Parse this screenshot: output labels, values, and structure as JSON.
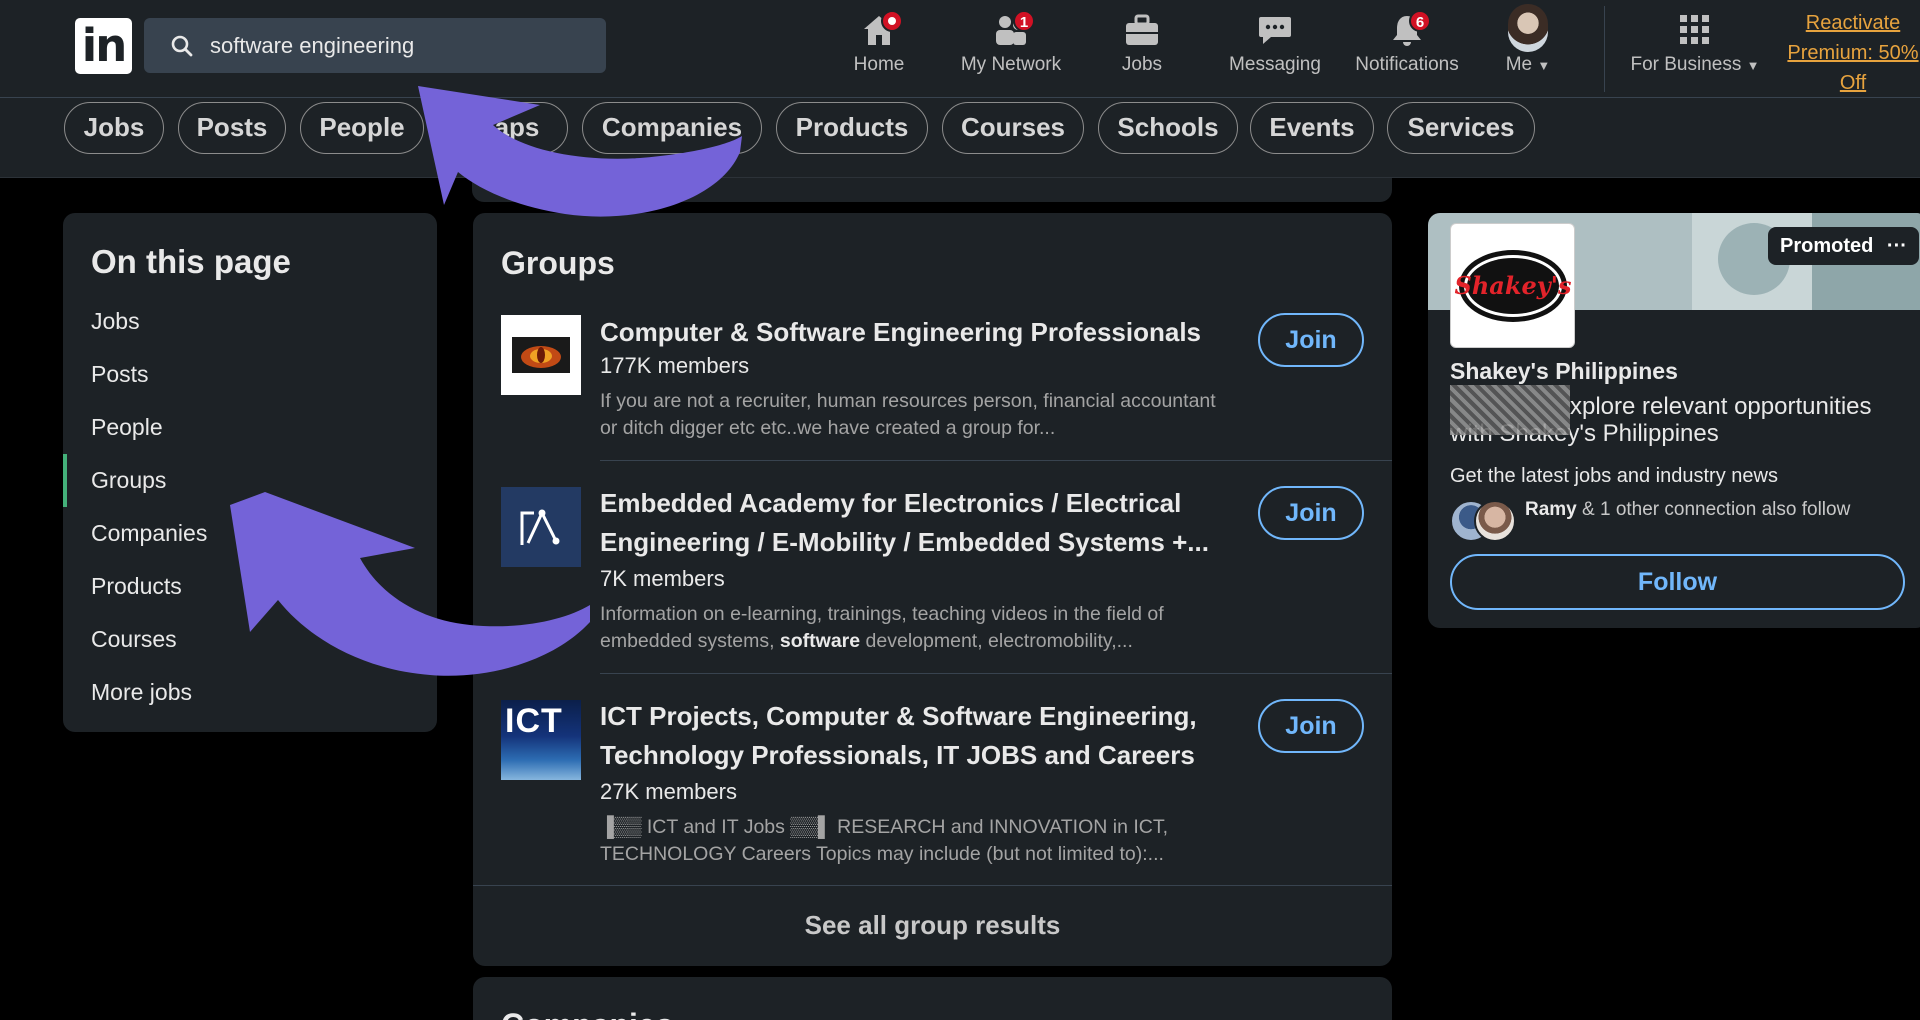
{
  "header": {
    "search": {
      "value": "software engineering"
    },
    "nav": [
      {
        "label": "Home",
        "badge": ""
      },
      {
        "label": "My Network",
        "badge": "1"
      },
      {
        "label": "Jobs",
        "badge": ""
      },
      {
        "label": "Messaging",
        "badge": ""
      },
      {
        "label": "Notifications",
        "badge": "6"
      },
      {
        "label": "Me",
        "badge": ""
      },
      {
        "label": "For Business",
        "badge": ""
      }
    ],
    "premium": {
      "line1": "Reactivate",
      "line2": "Premium: 50%",
      "line3": "Off"
    }
  },
  "filters": [
    "Jobs",
    "Posts",
    "People",
    "Groups",
    "Companies",
    "Products",
    "Courses",
    "Schools",
    "Events",
    "Services"
  ],
  "filters_visible": [
    "Jobs",
    "Posts",
    "People",
    "aps",
    "Companies",
    "Products",
    "Courses",
    "Schools",
    "Events",
    "Services"
  ],
  "sidebar": {
    "title": "On this page",
    "items": [
      "Jobs",
      "Posts",
      "People",
      "Groups",
      "Companies",
      "Products",
      "Courses",
      "More jobs"
    ],
    "active": "Groups"
  },
  "groups": {
    "title": "Groups",
    "join_label": "Join",
    "items": [
      {
        "name": "Computer & Software Engineering Professionals",
        "members": "177K members",
        "description": "If you are not a recruiter, human resources person, financial accountant or ditch digger etc etc..we have created a group for..."
      },
      {
        "name_line1": "Embedded Academy for Electronics / Electrical",
        "name_line2": "Engineering / E-Mobility / Embedded Systems +...",
        "members": "7K members",
        "description_pre": "Information on e-learning, trainings, teaching videos in the field of embedded systems, ",
        "description_bold": "software",
        "description_post": " development, electromobility,..."
      },
      {
        "name_line1": "ICT Projects, Computer & Software Engineering,",
        "name_line2": "Technology Professionals, IT JOBS and Careers",
        "members": "27K members",
        "thumb_text": "ICT",
        "description_line1": "▐▒▒ ICT and IT Jobs ▒▒▌ RESEARCH and INNOVATION in ICT,",
        "description_line2": "TECHNOLOGY Careers Topics may include (but not limited to):..."
      }
    ],
    "see_all": "See all group results"
  },
  "companies": {
    "title": "Companies"
  },
  "ad": {
    "promoted": "Promoted",
    "more": "···",
    "logo_text": "Shakey's",
    "name": "Shakey's Philippines",
    "headline_pre": "xplore relevant opportunities",
    "headline_line2": "with Shakey's Philippines",
    "subtitle": "Get the latest jobs and industry news",
    "connection_name": "Ramy",
    "connection_rest": " & 1 other connection also follow",
    "follow_label": "Follow"
  },
  "colors": {
    "accent_blue": "#71b7fb",
    "badge_red": "#d11124",
    "annotation_arrow": "#7463d8",
    "active_marker": "#44b17a",
    "premium": "#e7a33e"
  }
}
